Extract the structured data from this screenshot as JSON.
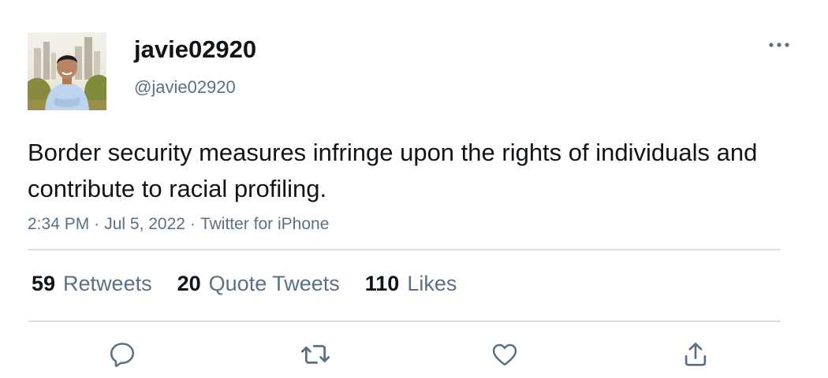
{
  "tweet": {
    "author": {
      "display_name": "javie02920",
      "handle": "@javie02920"
    },
    "text": "Border security measures infringe upon the rights of individuals and contribute to racial profiling.",
    "time": "2:34 PM",
    "date": "Jul 5, 2022",
    "source": "Twitter for iPhone",
    "separator": "·"
  },
  "stats": {
    "retweets": {
      "count": "59",
      "label": "Retweets"
    },
    "quote_tweets": {
      "count": "20",
      "label": "Quote Tweets"
    },
    "likes": {
      "count": "110",
      "label": "Likes"
    }
  },
  "actions": {
    "reply_icon": "reply-icon",
    "retweet_icon": "retweet-icon",
    "like_icon": "heart-icon",
    "share_icon": "share-icon",
    "more_icon": "more-options-icon"
  },
  "colors": {
    "text_primary": "#0f1419",
    "text_secondary": "#5b7083",
    "divider": "#dbe0e4"
  }
}
